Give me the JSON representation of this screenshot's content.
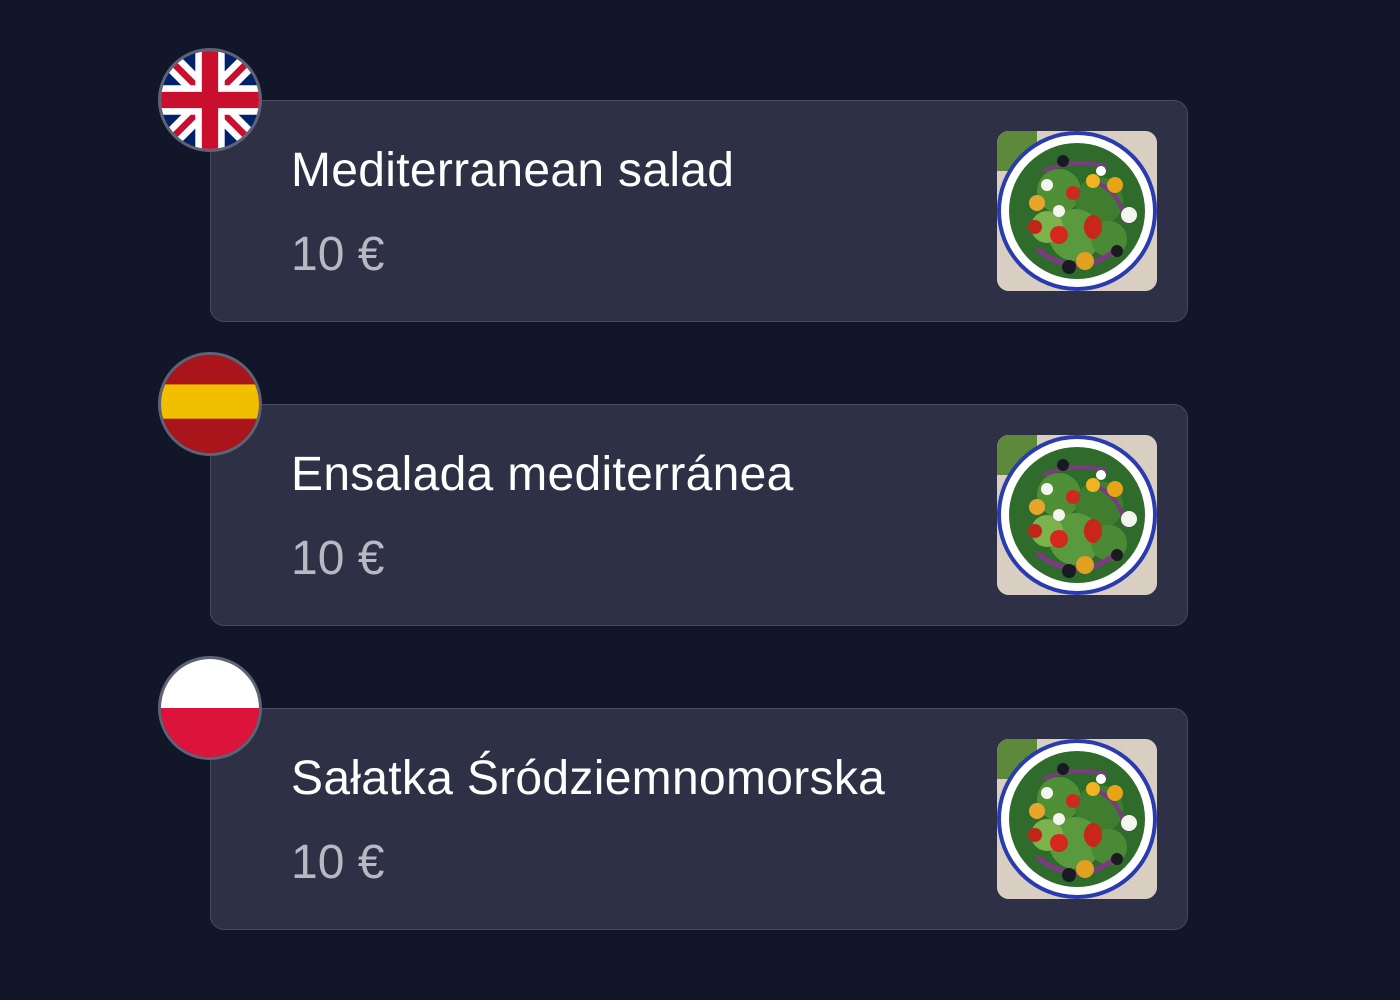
{
  "menu": {
    "items": [
      {
        "language": "English",
        "flag_icon": "uk-flag-icon",
        "name": "Mediterranean salad",
        "price": "10 €"
      },
      {
        "language": "Spanish",
        "flag_icon": "spain-flag-icon",
        "name": "Ensalada mediterránea",
        "price": "10 €"
      },
      {
        "language": "Polish",
        "flag_icon": "poland-flag-icon",
        "name": "Sałatka Śródziemnomorska",
        "price": "10 €"
      }
    ]
  },
  "colors": {
    "background": "#111629",
    "card": "#2e3146",
    "card_border": "#454a62",
    "title": "#ffffff",
    "price": "#b7b8c2"
  }
}
